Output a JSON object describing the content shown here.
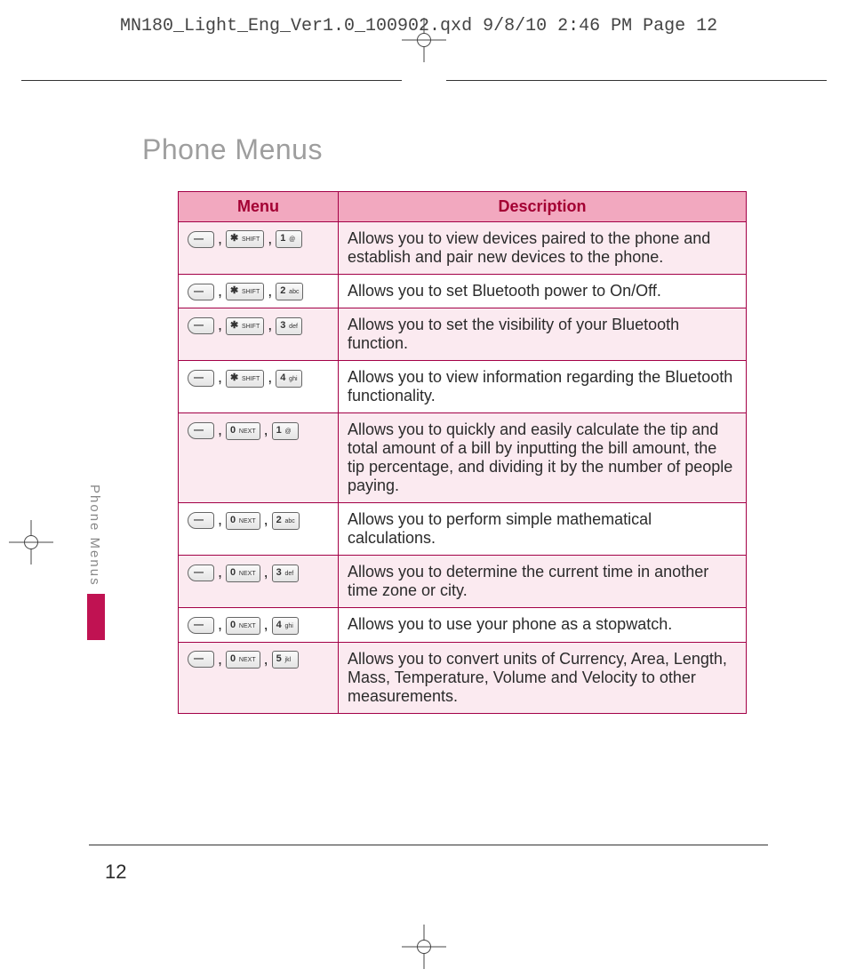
{
  "header": {
    "slug": "MN180_Light_Eng_Ver1.0_100902.qxd  9/8/10  2:46 PM  Page 12"
  },
  "title": "Phone Menus",
  "side_label": "Phone Menus",
  "page_number": "12",
  "columns": {
    "menu": "Menu",
    "description": "Description"
  },
  "keys": {
    "soft": "—",
    "star": "✱ SHIFT",
    "zero": "0 NEXT",
    "k1": "1 @",
    "k2": "2 abc",
    "k3": "3 def",
    "k4": "4 ghi",
    "k5": "5 jkl"
  },
  "rows": [
    {
      "seq": [
        "soft",
        "star",
        "k1"
      ],
      "desc": "Allows you to view devices paired to the phone and establish and pair new devices to the phone."
    },
    {
      "seq": [
        "soft",
        "star",
        "k2"
      ],
      "desc": "Allows you to set Bluetooth power to On/Off."
    },
    {
      "seq": [
        "soft",
        "star",
        "k3"
      ],
      "desc": "Allows you to set the visibility of your Bluetooth function."
    },
    {
      "seq": [
        "soft",
        "star",
        "k4"
      ],
      "desc": "Allows you to view information regarding the Bluetooth functionality."
    },
    {
      "seq": [
        "soft",
        "zero",
        "k1"
      ],
      "desc": "Allows you to quickly and easily calculate the tip and total amount of a bill by inputting the bill amount, the tip percentage, and dividing it by the number of people paying."
    },
    {
      "seq": [
        "soft",
        "zero",
        "k2"
      ],
      "desc": "Allows you to perform simple mathematical calculations."
    },
    {
      "seq": [
        "soft",
        "zero",
        "k3"
      ],
      "desc": "Allows you to determine the current time in another time zone or city."
    },
    {
      "seq": [
        "soft",
        "zero",
        "k4"
      ],
      "desc": "Allows you to use your phone as a stopwatch."
    },
    {
      "seq": [
        "soft",
        "zero",
        "k5"
      ],
      "desc": "Allows you to convert units of Currency, Area, Length, Mass, Temperature, Volume and Velocity to other measurements."
    }
  ]
}
